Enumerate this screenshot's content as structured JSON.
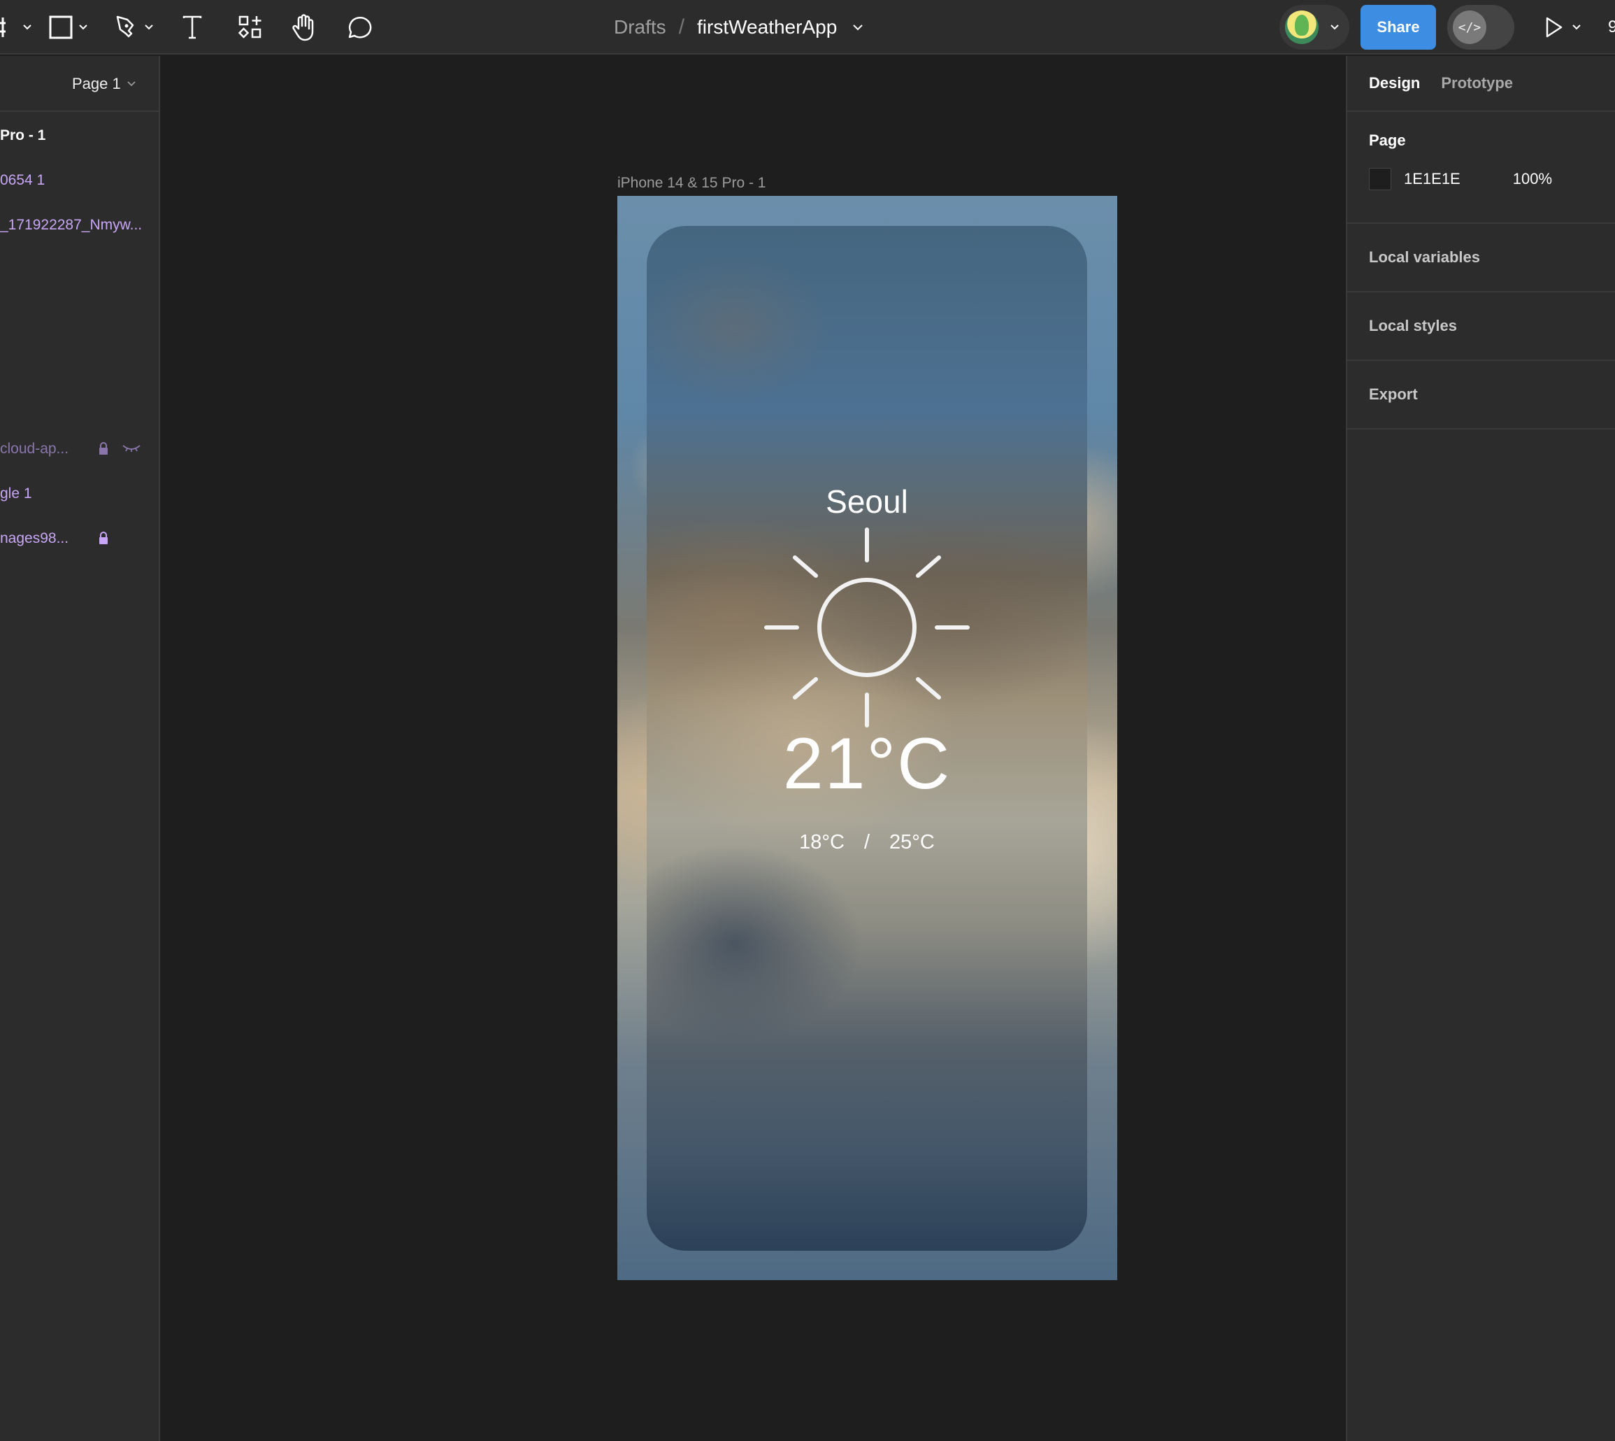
{
  "toolbar": {
    "tools": [
      {
        "name": "frame-tool",
        "has_menu": true
      },
      {
        "name": "shape-tool",
        "has_menu": true
      },
      {
        "name": "pen-tool",
        "has_menu": true
      },
      {
        "name": "text-tool",
        "has_menu": false
      },
      {
        "name": "actions-tool",
        "has_menu": false
      },
      {
        "name": "hand-tool",
        "has_menu": false
      },
      {
        "name": "comment-tool",
        "has_menu": false
      }
    ],
    "breadcrumb": {
      "folder": "Drafts",
      "separator": "/",
      "file": "firstWeatherApp"
    },
    "share_label": "Share",
    "dev_mode_icon": "</>",
    "zoom_partial": "9",
    "accent_color": "#3d8ee3"
  },
  "left_panel": {
    "page_selector": "Page 1",
    "layers": [
      {
        "label": "Pro - 1",
        "kind": "frame"
      },
      {
        "label": "0654 1",
        "kind": "image"
      },
      {
        "label": "_171922287_Nmyw...",
        "kind": "image"
      },
      {
        "label": "cloud-ap...",
        "kind": "image",
        "locked": true,
        "hidden": true
      },
      {
        "label": "gle 1",
        "kind": "shape"
      },
      {
        "label": "nages98...",
        "kind": "image",
        "locked": true
      }
    ]
  },
  "canvas": {
    "frame_label": "iPhone 14 & 15 Pro - 1",
    "weather": {
      "city": "Seoul",
      "icon": "sun-icon",
      "temperature": "21°C",
      "low": "18°C",
      "separator": "/",
      "high": "25°C"
    }
  },
  "right_panel": {
    "tabs": [
      {
        "label": "Design",
        "active": true
      },
      {
        "label": "Prototype",
        "active": false
      }
    ],
    "page_section": {
      "title": "Page",
      "color_hex": "1E1E1E",
      "opacity": "100%"
    },
    "sections": [
      "Local variables",
      "Local styles",
      "Export"
    ]
  }
}
